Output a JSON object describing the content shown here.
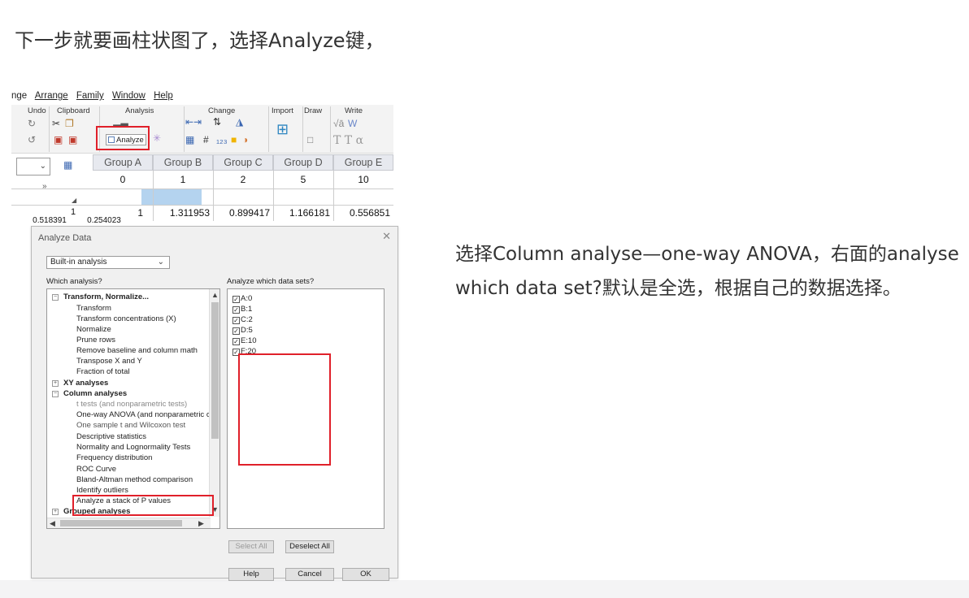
{
  "heading": "下一步就要画柱状图了，选择Analyze键，",
  "side_text": "选择Column analyse—one-way ANOVA，右面的analyse which data set?默认是全选，根据自己的数据选择。",
  "menubar": {
    "items": [
      "nge",
      "Arrange",
      "Family",
      "Window",
      "Help"
    ]
  },
  "ribbon": {
    "groups": [
      "Undo",
      "Clipboard",
      "Analysis",
      "Change",
      "Import",
      "Draw",
      "Write"
    ],
    "analyze_label": "Analyze"
  },
  "table": {
    "headers": [
      "Group A",
      "Group B",
      "Group C",
      "Group D",
      "Group E"
    ],
    "xrow": [
      "0",
      "1",
      "2",
      "5",
      "10"
    ],
    "row1_index": "1",
    "row1": [
      "1",
      "1.311953",
      "0.899417",
      "1.166181",
      "0.556851"
    ],
    "partial_row": [
      "0.518391",
      "0.254023"
    ],
    "expand_glyph": "»"
  },
  "dialog": {
    "title": "Analyze Data",
    "select_value": "Built-in analysis",
    "which_label": "Which analysis?",
    "datasets_label": "Analyze which data sets?",
    "analyses": [
      {
        "text": "Transform, Normalize...",
        "cat": true
      },
      {
        "text": "Transform"
      },
      {
        "text": "Transform concentrations (X)"
      },
      {
        "text": "Normalize"
      },
      {
        "text": "Prune rows"
      },
      {
        "text": "Remove baseline and column math"
      },
      {
        "text": "Transpose X and Y"
      },
      {
        "text": "Fraction of total"
      },
      {
        "text": "XY analyses",
        "cat": true
      },
      {
        "text": "Column analyses",
        "cat": true
      },
      {
        "text": "t tests (and nonparametric tests)"
      },
      {
        "text": "One-way ANOVA (and nonparametric or"
      },
      {
        "text": "One sample t and Wilcoxon test"
      },
      {
        "text": "Descriptive statistics"
      },
      {
        "text": "Normality and Lognormality Tests"
      },
      {
        "text": "Frequency distribution"
      },
      {
        "text": "ROC Curve"
      },
      {
        "text": "Bland-Altman method comparison"
      },
      {
        "text": "Identify outliers"
      },
      {
        "text": "Analyze a stack of P values"
      },
      {
        "text": "Grouped analyses",
        "cat": true
      }
    ],
    "datasets": [
      "A:0",
      "B:1",
      "C:2",
      "D:5",
      "E:10",
      "F:20"
    ],
    "buttons": {
      "select_all": "Select All",
      "deselect_all": "Deselect All",
      "help": "Help",
      "cancel": "Cancel",
      "ok": "OK"
    }
  }
}
